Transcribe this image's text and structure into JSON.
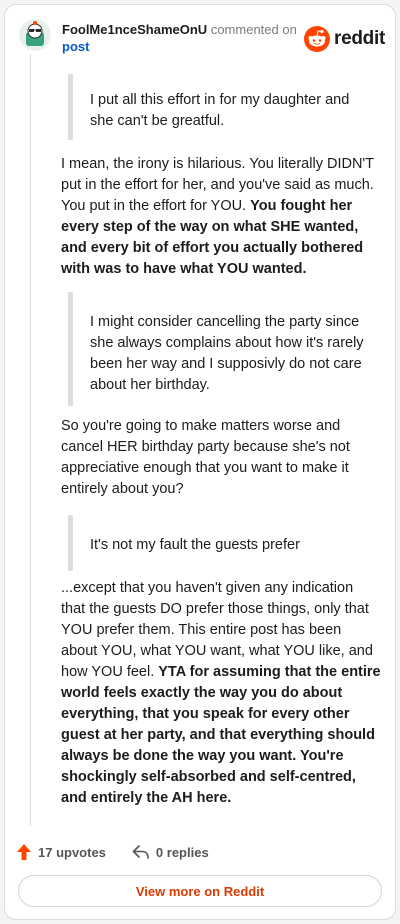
{
  "header": {
    "author": "FoolMe1nceShameOnU",
    "commented_on": "commented on",
    "post_link": "post",
    "brand_name": "reddit",
    "brand_color": "#ff4500"
  },
  "comment": {
    "quote1": "I put all this effort in for my daughter and she can't be greatful.",
    "para1_normal": "I mean, the irony is hilarious. You literally DIDN'T put in the effort for her, and you've said as much. You put in the effort for YOU. ",
    "para1_bold": "You fought her every step of the way on what SHE wanted, and every bit of effort you actually bothered with was to have what YOU wanted.",
    "quote2": "I might consider cancelling the party since she always complains about how it's rarely been her way and I supposivly do not care about her birthday.",
    "para2": "So you're going to make matters worse and cancel HER birthday party because she's not appreciative enough that you want to make it entirely about you?",
    "quote3": "It's not my fault the guests prefer",
    "para3_normal": "...except that you haven't given any indication that the guests DO prefer those things, only that YOU prefer them. This entire post has been about YOU, what YOU want, what YOU like, and how YOU feel. ",
    "para3_bold": "YTA for assuming that the entire world feels exactly the way you do about everything, that you speak for every other guest at her party, and that everything should always be done the way you want. You're shockingly self-absorbed and self-centred, and entirely the AH here."
  },
  "actions": {
    "upvotes": "17 upvotes",
    "replies": "0 replies",
    "upvote_icon": "upvote-arrow-icon",
    "reply_icon": "reply-arrow-icon"
  },
  "footer": {
    "view_more": "View more on Reddit"
  },
  "colors": {
    "upvote": "#ff4500",
    "link": "#0a58ca",
    "view_more": "#d93a00"
  }
}
